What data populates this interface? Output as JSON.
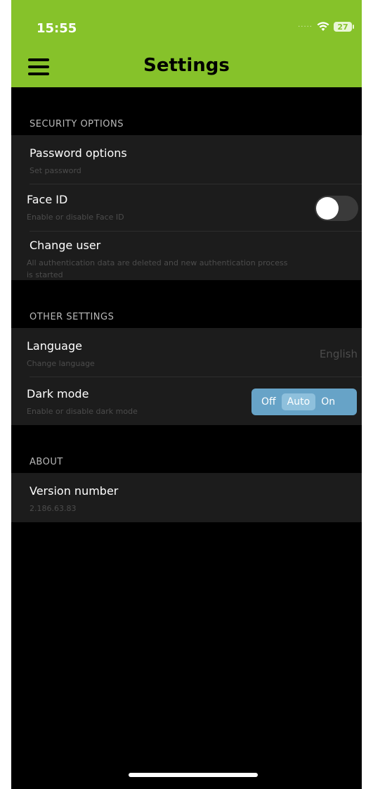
{
  "status_bar": {
    "time": "15:55",
    "battery": "27"
  },
  "nav": {
    "title": "Settings"
  },
  "sections": {
    "security": {
      "header": "SECURITY OPTIONS",
      "password": {
        "title": "Password options",
        "subtitle": "Set password"
      },
      "face_id": {
        "title": "Face ID",
        "subtitle": "Enable or disable Face ID",
        "enabled": false
      },
      "change_user": {
        "title": "Change user",
        "subtitle_line1": "All authentication data are deleted and new authentication process",
        "subtitle_line2": "is started"
      }
    },
    "other": {
      "header": "OTHER SETTINGS",
      "language": {
        "title": "Language",
        "subtitle": "Change language",
        "value": "English"
      },
      "dark_mode": {
        "title": "Dark mode",
        "subtitle": "Enable or disable dark mode",
        "options": [
          "Off",
          "Auto",
          "On"
        ],
        "selected": "Auto"
      }
    },
    "about": {
      "header": "ABOUT",
      "version": {
        "title": "Version number",
        "subtitle": "2.186.63.83"
      }
    }
  },
  "colors": {
    "accent_green": "#86c22a",
    "segment_blue": "#67a3c7",
    "row_background": "#1c1c1c"
  }
}
